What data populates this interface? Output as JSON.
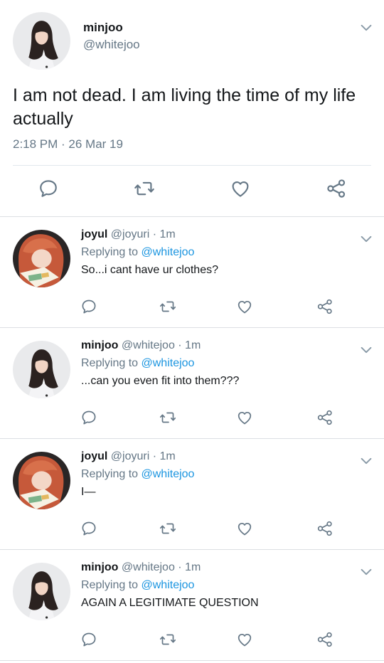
{
  "main_tweet": {
    "author_name": "minjoo",
    "author_handle": "@whitejoo",
    "text": "I am not dead. I am living the time of my life actually",
    "timestamp": "2:18 PM · 26 Mar 19",
    "avatar": "minjoo-avatar"
  },
  "replies": [
    {
      "author_name": "joyul",
      "author_handle": "@joyuri · 1m",
      "replying_prefix": "Replying to ",
      "replying_to": "@whitejoo",
      "text": "So...i cant have ur clothes?",
      "avatar": "joyul-avatar"
    },
    {
      "author_name": "minjoo",
      "author_handle": "@whitejoo · 1m",
      "replying_prefix": "Replying to ",
      "replying_to": "@whitejoo",
      "text": "...can you even fit into them???",
      "avatar": "minjoo-avatar"
    },
    {
      "author_name": "joyul",
      "author_handle": "@joyuri · 1m",
      "replying_prefix": "Replying to ",
      "replying_to": "@whitejoo",
      "text": "I—",
      "avatar": "joyul-avatar"
    },
    {
      "author_name": "minjoo",
      "author_handle": "@whitejoo · 1m",
      "replying_prefix": "Replying to ",
      "replying_to": "@whitejoo",
      "text": "AGAIN A LEGITIMATE QUESTION",
      "avatar": "minjoo-avatar"
    }
  ],
  "colors": {
    "text": "#14171a",
    "secondary": "#657786",
    "link": "#1b95e0",
    "divider": "#e1e8ed"
  },
  "icons": [
    "reply-icon",
    "retweet-icon",
    "like-icon",
    "share-icon",
    "chevron-down-icon"
  ]
}
